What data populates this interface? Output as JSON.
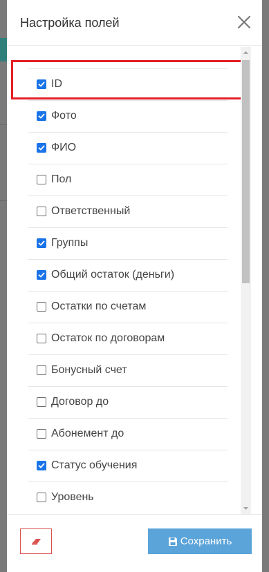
{
  "dialog": {
    "title": "Настройка полей",
    "close_icon": "close-icon"
  },
  "fields": [
    {
      "label": "ID",
      "checked": true
    },
    {
      "label": "Фото",
      "checked": true
    },
    {
      "label": "ФИО",
      "checked": true
    },
    {
      "label": "Пол",
      "checked": false
    },
    {
      "label": "Ответственный",
      "checked": false
    },
    {
      "label": "Группы",
      "checked": true
    },
    {
      "label": "Общий остаток (деньги)",
      "checked": true
    },
    {
      "label": "Остатки по счетам",
      "checked": false
    },
    {
      "label": "Остаток по договорам",
      "checked": false
    },
    {
      "label": "Бонусный счет",
      "checked": false
    },
    {
      "label": "Договор до",
      "checked": false
    },
    {
      "label": "Абонемент до",
      "checked": false
    },
    {
      "label": "Статус обучения",
      "checked": true
    },
    {
      "label": "Уровень",
      "checked": false
    }
  ],
  "footer": {
    "reset_icon": "eraser-icon",
    "save_label": "Сохранить",
    "save_icon": "floppy-disk-icon"
  },
  "colors": {
    "checkbox_checked": "#1a73e8",
    "save_button": "#5ba4d9",
    "highlight": "#e31e24",
    "reset_border": "#d9534f"
  }
}
